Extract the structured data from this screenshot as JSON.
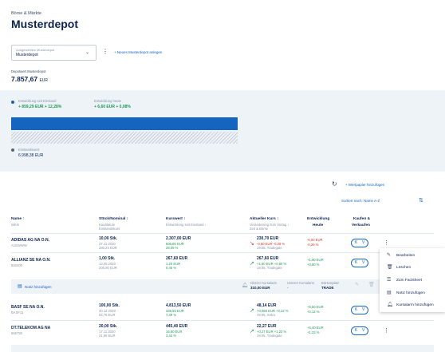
{
  "header": {
    "breadcrumb": "Börse & Märkte",
    "title": "Musterdepot"
  },
  "depot_select": {
    "label": "Ausgewähltes Musterdepot",
    "value": "Musterdepot"
  },
  "new_depot": "+ Neues Musterdepot anlegen",
  "depot_value": {
    "label": "Depotwert Musterdepot",
    "value": "7.857,67",
    "currency": "EUR"
  },
  "perf": {
    "since_deposit_label": "Entwicklung seit Einstand",
    "since_deposit_value": "+ 859,29 EUR   + 12,28%",
    "today_label": "Entwicklung heute",
    "today_value": "+ 6,60 EUR   + 0,08%",
    "deposit_label": "Einstandswert",
    "deposit_value": "6.998,38 EUR"
  },
  "actions": {
    "add_security": "+ Wertpapier hinzufügen",
    "sort": "Sortiert nach: Name A-Z"
  },
  "columns": {
    "name": "Name ↑",
    "name_sub": "WKN",
    "qty": "Stück/Nominal ↕",
    "qty_sub1": "Kaufdatum",
    "qty_sub2": "Einstandskurs",
    "value": "Kurswert ↕",
    "value_sub": "Entwicklung seit Einstand ↕",
    "price": "Aktueller Kurs ↕",
    "price_sub": "Veränderung zum Vortag ↕",
    "price_sub2": "Zeit & Börse",
    "change": "Entwicklung",
    "change2": "Heute",
    "trade": "Kaufen &",
    "trade2": "Verkaufen"
  },
  "rows": [
    {
      "name": "ADIDAS AG NA O.N.",
      "wkn": "A1EWWW",
      "qty": "10,00 Stk.",
      "date": "27.11.2020",
      "entry": "280,24 EUR",
      "value": "2.307,00 EUR",
      "value_ch": "506,80 EUR",
      "value_pct": "28,09 %",
      "price": "230,70 EUR",
      "price_ch": "-0,60 EUR -0,26 %",
      "price_time": "19:05, Tradegate",
      "today": "-6,00 EUR",
      "today_pct": "-0,26 %"
    },
    {
      "name": "ALLIANZ SE NA O.N.",
      "wkn": "840400",
      "qty": "1,00 Stk.",
      "date": "13.05.2020",
      "entry": "205,90 EUR",
      "value": "267,60 EUR",
      "value_ch": "1,20 EUR",
      "value_pct": "0,45 %",
      "price": "267,60 EUR",
      "price_ch": "+1,60 EUR +0,60 %",
      "price_time": "19:05, Tradegate",
      "today": "+1,60 EUR",
      "today_pct": "+0,60 %"
    },
    {
      "name": "BASF SE NA O.N.",
      "wkn": "BASF11",
      "qty": "100,00 Stk.",
      "date": "30.12.2020",
      "entry": "64,78 EUR",
      "value": "4.813,50 EUR",
      "value_ch": "335,50 EUR",
      "value_pct": "7,49 %",
      "price": "48,14 EUR",
      "price_ch": "+0,055 EUR +0,12 %",
      "price_time": "19:05, Xetra",
      "today": "+5,50 EUR",
      "today_pct": "+0,12 %"
    },
    {
      "name": "DT.TELEKOM AG NA",
      "wkn": "555750",
      "qty": "20,00 Stk.",
      "date": "17.11.2020",
      "entry": "21,69 EUR",
      "value": "445,40 EUR",
      "value_ch": "16,80 EUR",
      "value_pct": "3,44 %",
      "price": "22,27 EUR",
      "price_ch": "+0,27 EUR +1,23 %",
      "price_time": "19:05, Tradegate",
      "today": "+5,40 EUR",
      "today_pct": "+1,23 %"
    }
  ],
  "note_bar": {
    "add_note": "Notiz hinzufügen",
    "upper_label": "Oberer Kursalarm",
    "upper_value": "310,00 EUR",
    "lower_label": "Unterer Kursalarm",
    "lower_value": "-",
    "exchange_label": "Börsenplatz",
    "exchange_value": "TRADE"
  },
  "buy_label": "K",
  "sell_label": "V",
  "context_menu": [
    "Bearbeiten",
    "Löschen",
    "Zum Factsheet",
    "Notiz hinzufügen",
    "Kursalarm hinzufügen"
  ],
  "colors": {
    "primary": "#1565c0",
    "navy": "#0d2450",
    "green": "#1f9a57",
    "red": "#d0342c",
    "panel": "#eef3f8"
  }
}
